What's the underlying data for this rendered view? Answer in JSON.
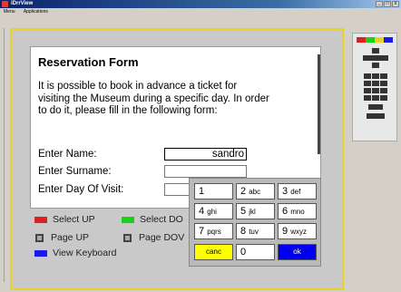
{
  "window": {
    "title": "iDrrView"
  },
  "menu": {
    "items": [
      "Menu",
      "Applications"
    ]
  },
  "form": {
    "title": "Reservation Form",
    "intro": "It is possible to book in advance a ticket for visiting the Museum during a specific day. In order to do it, please fill in the following form:",
    "name_label": "Enter Name:",
    "name_value": "sandro",
    "surname_label": "Enter Surname:",
    "surname_value": "",
    "day_label": "Enter Day Of Visit:",
    "day_value": ""
  },
  "legend": {
    "select_up": "Select UP",
    "select_down": "Select DO",
    "page_up": "Page UP",
    "page_down": "Page DOV",
    "view_keyboard": "View Keyboard",
    "colors": {
      "red": "#e02020",
      "green": "#1ad11a",
      "blue": "#1a1aee"
    }
  },
  "keypad": {
    "keys": [
      {
        "digit": "1",
        "letters": ""
      },
      {
        "digit": "2",
        "letters": "abc"
      },
      {
        "digit": "3",
        "letters": "def"
      },
      {
        "digit": "4",
        "letters": "ghi"
      },
      {
        "digit": "5",
        "letters": "jkl"
      },
      {
        "digit": "6",
        "letters": "mno"
      },
      {
        "digit": "7",
        "letters": "pqrs"
      },
      {
        "digit": "8",
        "letters": "tuv"
      },
      {
        "digit": "9",
        "letters": "wxyz"
      }
    ],
    "cancel": "canc",
    "zero": "0",
    "ok": "ok"
  }
}
